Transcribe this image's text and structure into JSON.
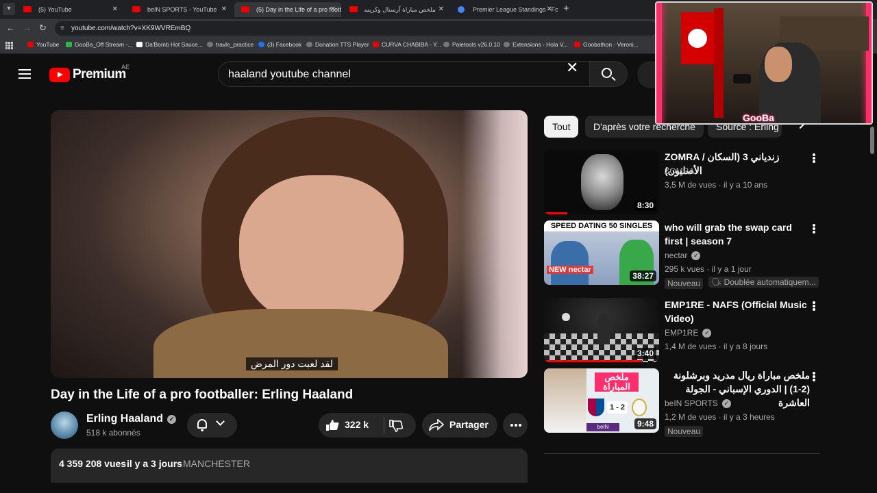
{
  "browser": {
    "tabs": [
      {
        "title": "(5) YouTube",
        "active": false
      },
      {
        "title": "beIN SPORTS - YouTube",
        "active": false
      },
      {
        "title": "(5) Day in the Life of a pro footb",
        "active": true
      },
      {
        "title": "ملخص مباراة آرسنال وكريستال بالا",
        "active": false
      },
      {
        "title": "Premier League Standings - Foo",
        "active": false
      }
    ],
    "url": "youtube.com/watch?v=XK9WVREmBQ",
    "bookmarks": [
      "YouTube",
      "GooBa_Off Stream -...",
      "Da'Bomb Hot Sauce...",
      "travle_practice",
      "(3) Facebook",
      "Donation TTS Player",
      "CURVA CHABIBA - Y...",
      "Paletools v26.0.10",
      "Extensions - Hola V...",
      "Goobathon - Veroni..."
    ]
  },
  "header": {
    "logo_text": "Premium",
    "country_code": "AE",
    "search_value": "haaland youtube channel"
  },
  "video": {
    "subtitle": "لقد لعبت دور المرض",
    "title": "Day in the Life of a pro footballer: Erling Haaland",
    "channel": "Erling Haaland",
    "subscribers": "518 k abonnés",
    "likes": "322 k",
    "share_label": "Partager",
    "views": "4 359 208 vues",
    "uploaded": "il y a 3 jours",
    "location_tag": "MANCHESTER"
  },
  "chips": [
    "Tout",
    "D'après votre recherche",
    "Source : Erling"
  ],
  "recommendations": [
    {
      "title": "ZOMRA / زندياني 3 (السكان الأصليون)",
      "channel": "ZOMRA",
      "views": "3,5 M de vues",
      "ago": "il y a 10 ans",
      "duration": "8:30",
      "progress": 0.2,
      "rtl": false
    },
    {
      "title": "who will grab the swap card first | season 7",
      "channel": "nectar",
      "views": "295 k vues",
      "ago": "il y a 1 jour",
      "duration": "38:27",
      "badge": "Nouveau",
      "dubbed": "Doublée automatiquem...",
      "thumb_banner": "SPEED DATING 50 SINGLES",
      "thumb_tag": "NEW nectar",
      "rtl": false
    },
    {
      "title": "EMP1RE - NAFS (Official Music Video)",
      "channel": "EMP1RE",
      "views": "1,4 M de vues",
      "ago": "il y a 8 jours",
      "duration": "3:40",
      "progress": 0.85,
      "rtl": false
    },
    {
      "title": "ملخص مباراة ريال مدريد وبرشلونة (2-1) | الدوري الإسباني - الجولة العاشرة",
      "channel": "beIN SPORTS",
      "views": "1,2 M de vues",
      "ago": "il y a 3 heures",
      "duration": "9:48",
      "badge": "Nouveau",
      "thumb_banner": "ملخص المباراة",
      "thumb_score": "1 - 2",
      "rtl": true
    }
  ],
  "webcam": {
    "label": "GooBa"
  },
  "colors": {
    "accent": "#ff0000",
    "background": "#0f0f0f",
    "surface": "#272727"
  }
}
